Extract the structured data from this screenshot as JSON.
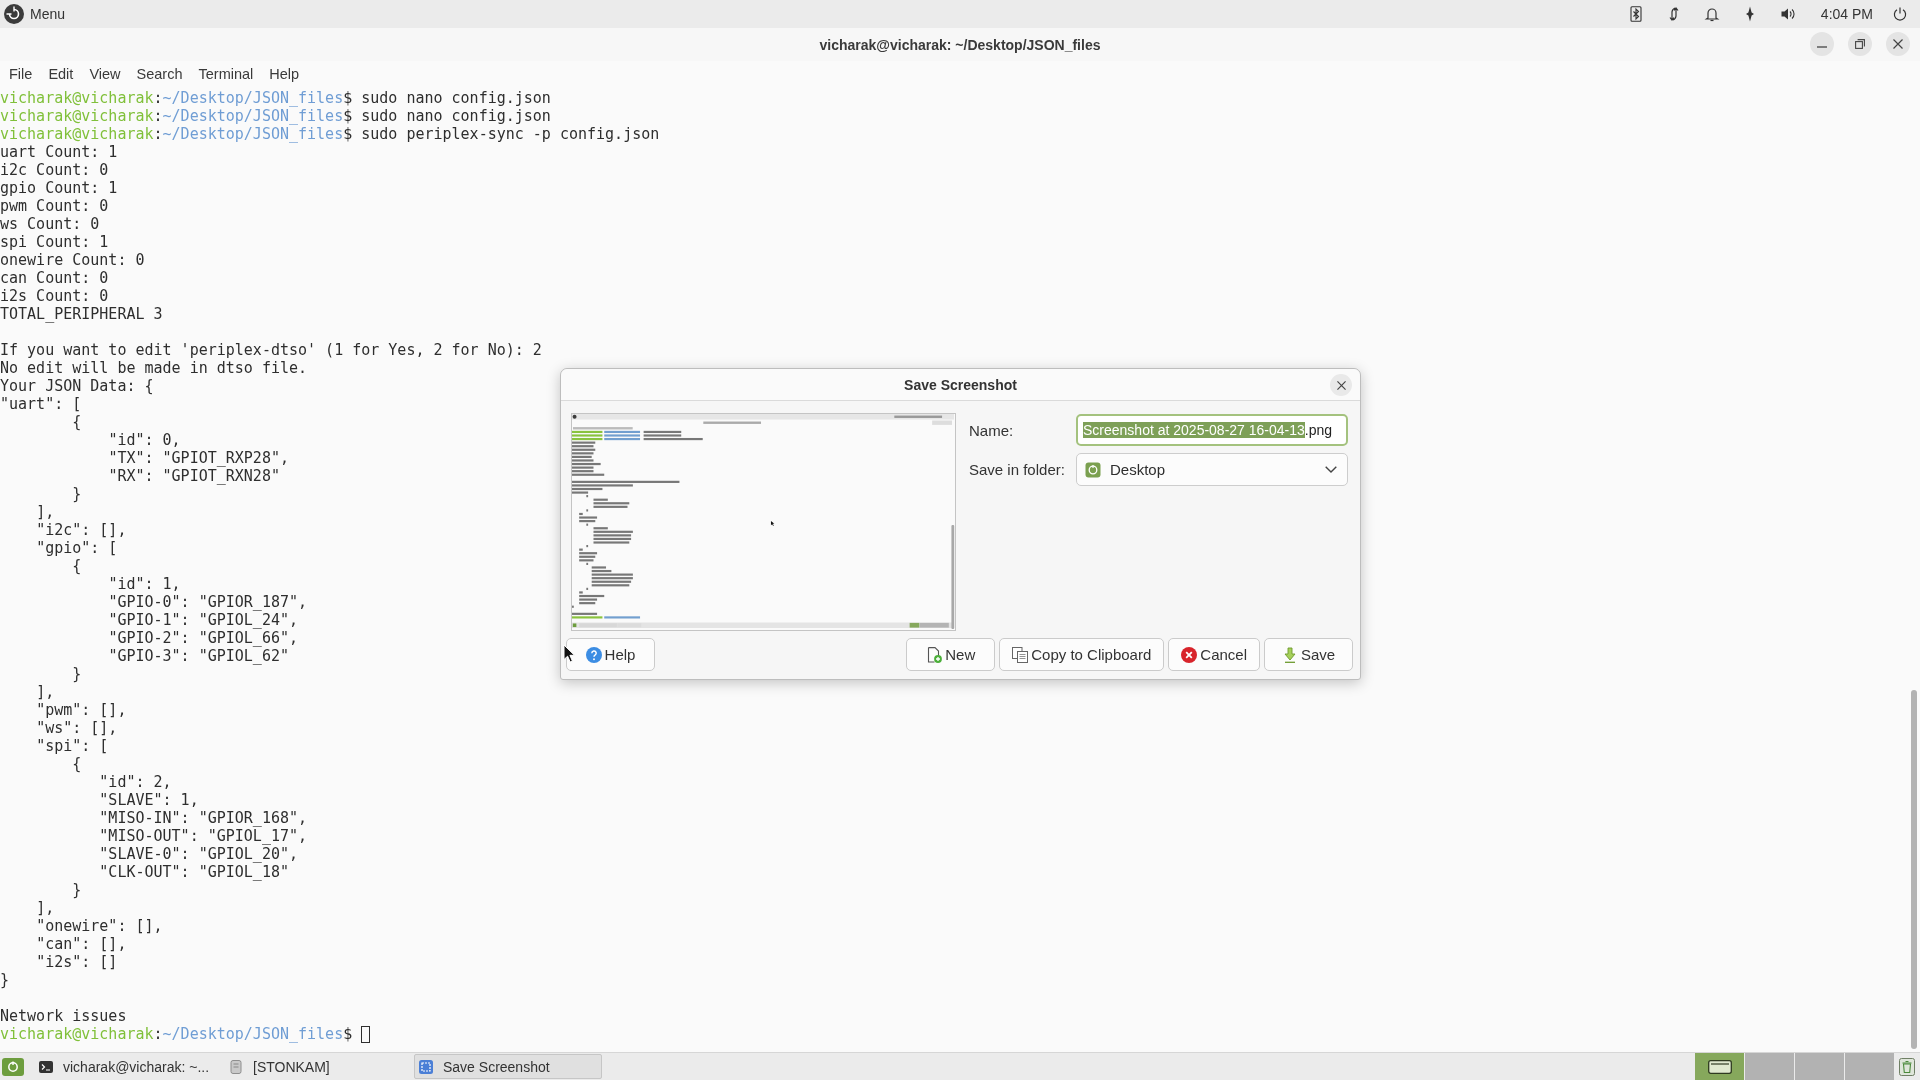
{
  "top_panel": {
    "menu_label": "Menu",
    "clock": "4:04 PM"
  },
  "window": {
    "title": "vicharak@vicharak: ~/Desktop/JSON_files"
  },
  "menu_bar": [
    "File",
    "Edit",
    "View",
    "Search",
    "Terminal",
    "Help"
  ],
  "terminal": {
    "cursor_visible": true,
    "lines": [
      {
        "kind": "prompt",
        "user": "vicharak@vicharak",
        "separator": ":",
        "path": "~/Desktop/JSON_files",
        "symbol": "$",
        "command": "sudo nano config.json"
      },
      {
        "kind": "prompt",
        "user": "vicharak@vicharak",
        "separator": ":",
        "path": "~/Desktop/JSON_files",
        "symbol": "$",
        "command": "sudo nano config.json"
      },
      {
        "kind": "prompt",
        "user": "vicharak@vicharak",
        "separator": ":",
        "path": "~/Desktop/JSON_files",
        "symbol": "$",
        "command": "sudo periplex-sync -p config.json"
      },
      {
        "kind": "output",
        "text": "uart Count: 1"
      },
      {
        "kind": "output",
        "text": "i2c Count: 0"
      },
      {
        "kind": "output",
        "text": "gpio Count: 1"
      },
      {
        "kind": "output",
        "text": "pwm Count: 0"
      },
      {
        "kind": "output",
        "text": "ws Count: 0"
      },
      {
        "kind": "output",
        "text": "spi Count: 1"
      },
      {
        "kind": "output",
        "text": "onewire Count: 0"
      },
      {
        "kind": "output",
        "text": "can Count: 0"
      },
      {
        "kind": "output",
        "text": "i2s Count: 0"
      },
      {
        "kind": "output",
        "text": "TOTAL_PERIPHERAL 3"
      },
      {
        "kind": "blank"
      },
      {
        "kind": "output",
        "text": "If you want to edit 'periplex-dtso' (1 for Yes, 2 for No): 2"
      },
      {
        "kind": "output",
        "text": "No edit will be made in dtso file."
      },
      {
        "kind": "output",
        "text": "Your JSON Data: {"
      },
      {
        "kind": "output",
        "text": "\"uart\": ["
      },
      {
        "kind": "output",
        "text": "        {"
      },
      {
        "kind": "output",
        "text": "            \"id\": 0,"
      },
      {
        "kind": "output",
        "text": "            \"TX\": \"GPIOT_RXP28\","
      },
      {
        "kind": "output",
        "text": "            \"RX\": \"GPIOT_RXN28\""
      },
      {
        "kind": "output",
        "text": "        }"
      },
      {
        "kind": "output",
        "text": "    ],"
      },
      {
        "kind": "output",
        "text": "    \"i2c\": [],"
      },
      {
        "kind": "output",
        "text": "    \"gpio\": ["
      },
      {
        "kind": "output",
        "text": "        {"
      },
      {
        "kind": "output",
        "text": "            \"id\": 1,"
      },
      {
        "kind": "output",
        "text": "            \"GPIO-0\": \"GPIOR_187\","
      },
      {
        "kind": "output",
        "text": "            \"GPIO-1\": \"GPIOL_24\","
      },
      {
        "kind": "output",
        "text": "            \"GPIO-2\": \"GPIOL_66\","
      },
      {
        "kind": "output",
        "text": "            \"GPIO-3\": \"GPIOL_62\""
      },
      {
        "kind": "output",
        "text": "        }"
      },
      {
        "kind": "output",
        "text": "    ],"
      },
      {
        "kind": "output",
        "text": "    \"pwm\": [],"
      },
      {
        "kind": "output",
        "text": "    \"ws\": [],"
      },
      {
        "kind": "output",
        "text": "    \"spi\": ["
      },
      {
        "kind": "output",
        "text": "        {"
      },
      {
        "kind": "output",
        "text": "           \"id\": 2,"
      },
      {
        "kind": "output",
        "text": "           \"SLAVE\": 1,"
      },
      {
        "kind": "output",
        "text": "           \"MISO-IN\": \"GPIOR_168\","
      },
      {
        "kind": "output",
        "text": "           \"MISO-OUT\": \"GPIOL_17\","
      },
      {
        "kind": "output",
        "text": "           \"SLAVE-0\": \"GPIOL_20\","
      },
      {
        "kind": "output",
        "text": "           \"CLK-OUT\": \"GPIOL_18\""
      },
      {
        "kind": "output",
        "text": "        }"
      },
      {
        "kind": "output",
        "text": "    ],"
      },
      {
        "kind": "output",
        "text": "    \"onewire\": [],"
      },
      {
        "kind": "output",
        "text": "    \"can\": [],"
      },
      {
        "kind": "output",
        "text": "    \"i2s\": []"
      },
      {
        "kind": "output",
        "text": "}"
      },
      {
        "kind": "blank"
      },
      {
        "kind": "output",
        "text": "Network issues"
      },
      {
        "kind": "prompt",
        "user": "vicharak@vicharak",
        "separator": ":",
        "path": "~/Desktop/JSON_files",
        "symbol": "$"
      }
    ]
  },
  "dialog": {
    "title": "Save Screenshot",
    "name_label": "Name:",
    "name_field": {
      "value_parts": [
        {
          "text": "Screenshot at 2025-08-27 16-04-13",
          "selected": true
        },
        {
          "text": ".png",
          "selected": false
        }
      ]
    },
    "folder_label": "Save in folder:",
    "folder": "Desktop",
    "buttons": [
      {
        "kind": "help",
        "label": "Help"
      },
      {
        "kind": "new",
        "label": "New"
      },
      {
        "kind": "copy",
        "label": "Copy to Clipboard"
      },
      {
        "kind": "cancel",
        "label": "Cancel"
      },
      {
        "kind": "save",
        "label": "Save"
      }
    ]
  },
  "taskbar": {
    "items": [
      {
        "kind": "terminal",
        "label": "vicharak@vicharak: ~...",
        "selected": false
      },
      {
        "kind": "generic",
        "label": "[STONKAM]",
        "selected": false
      },
      {
        "kind": "screenshot",
        "label": "Save Screenshot",
        "selected": true
      }
    ],
    "workspaces": [
      {
        "selected": true
      },
      {
        "selected": false
      },
      {
        "selected": false
      },
      {
        "selected": false
      }
    ]
  }
}
